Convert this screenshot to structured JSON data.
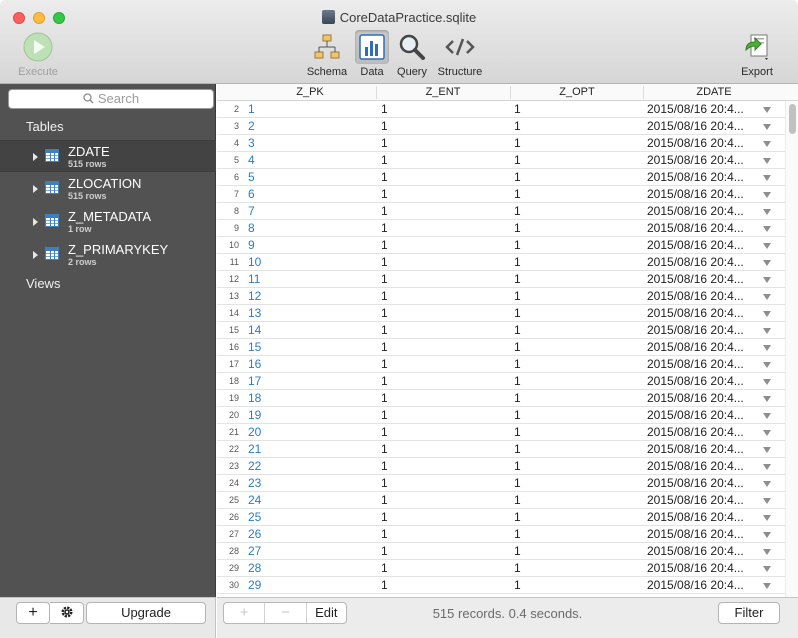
{
  "window": {
    "title": "CoreDataPractice.sqlite"
  },
  "toolbar": {
    "execute_label": "Execute",
    "schema_label": "Schema",
    "data_label": "Data",
    "query_label": "Query",
    "structure_label": "Structure",
    "export_label": "Export"
  },
  "sidebar": {
    "search_placeholder": "Search",
    "tables_heading": "Tables",
    "views_heading": "Views",
    "tables": [
      {
        "name": "ZDATE",
        "rows": "515 rows"
      },
      {
        "name": "ZLOCATION",
        "rows": "515 rows"
      },
      {
        "name": "Z_METADATA",
        "rows": "1 row"
      },
      {
        "name": "Z_PRIMARYKEY",
        "rows": "2 rows"
      }
    ],
    "add_label": "+",
    "upgrade_label": "Upgrade"
  },
  "grid": {
    "columns": [
      "Z_PK",
      "Z_ENT",
      "Z_OPT",
      "ZDATE"
    ],
    "rows": [
      {
        "n": "2",
        "pk": "1",
        "ent": "1",
        "opt": "1",
        "date": "2015/08/16 20:4..."
      },
      {
        "n": "3",
        "pk": "2",
        "ent": "1",
        "opt": "1",
        "date": "2015/08/16 20:4..."
      },
      {
        "n": "4",
        "pk": "3",
        "ent": "1",
        "opt": "1",
        "date": "2015/08/16 20:4..."
      },
      {
        "n": "5",
        "pk": "4",
        "ent": "1",
        "opt": "1",
        "date": "2015/08/16 20:4..."
      },
      {
        "n": "6",
        "pk": "5",
        "ent": "1",
        "opt": "1",
        "date": "2015/08/16 20:4..."
      },
      {
        "n": "7",
        "pk": "6",
        "ent": "1",
        "opt": "1",
        "date": "2015/08/16 20:4..."
      },
      {
        "n": "8",
        "pk": "7",
        "ent": "1",
        "opt": "1",
        "date": "2015/08/16 20:4..."
      },
      {
        "n": "9",
        "pk": "8",
        "ent": "1",
        "opt": "1",
        "date": "2015/08/16 20:4..."
      },
      {
        "n": "10",
        "pk": "9",
        "ent": "1",
        "opt": "1",
        "date": "2015/08/16 20:4..."
      },
      {
        "n": "11",
        "pk": "10",
        "ent": "1",
        "opt": "1",
        "date": "2015/08/16 20:4..."
      },
      {
        "n": "12",
        "pk": "11",
        "ent": "1",
        "opt": "1",
        "date": "2015/08/16 20:4..."
      },
      {
        "n": "13",
        "pk": "12",
        "ent": "1",
        "opt": "1",
        "date": "2015/08/16 20:4..."
      },
      {
        "n": "14",
        "pk": "13",
        "ent": "1",
        "opt": "1",
        "date": "2015/08/16 20:4..."
      },
      {
        "n": "15",
        "pk": "14",
        "ent": "1",
        "opt": "1",
        "date": "2015/08/16 20:4..."
      },
      {
        "n": "16",
        "pk": "15",
        "ent": "1",
        "opt": "1",
        "date": "2015/08/16 20:4..."
      },
      {
        "n": "17",
        "pk": "16",
        "ent": "1",
        "opt": "1",
        "date": "2015/08/16 20:4..."
      },
      {
        "n": "18",
        "pk": "17",
        "ent": "1",
        "opt": "1",
        "date": "2015/08/16 20:4..."
      },
      {
        "n": "19",
        "pk": "18",
        "ent": "1",
        "opt": "1",
        "date": "2015/08/16 20:4..."
      },
      {
        "n": "20",
        "pk": "19",
        "ent": "1",
        "opt": "1",
        "date": "2015/08/16 20:4..."
      },
      {
        "n": "21",
        "pk": "20",
        "ent": "1",
        "opt": "1",
        "date": "2015/08/16 20:4..."
      },
      {
        "n": "22",
        "pk": "21",
        "ent": "1",
        "opt": "1",
        "date": "2015/08/16 20:4..."
      },
      {
        "n": "23",
        "pk": "22",
        "ent": "1",
        "opt": "1",
        "date": "2015/08/16 20:4..."
      },
      {
        "n": "24",
        "pk": "23",
        "ent": "1",
        "opt": "1",
        "date": "2015/08/16 20:4..."
      },
      {
        "n": "25",
        "pk": "24",
        "ent": "1",
        "opt": "1",
        "date": "2015/08/16 20:4..."
      },
      {
        "n": "26",
        "pk": "25",
        "ent": "1",
        "opt": "1",
        "date": "2015/08/16 20:4..."
      },
      {
        "n": "27",
        "pk": "26",
        "ent": "1",
        "opt": "1",
        "date": "2015/08/16 20:4..."
      },
      {
        "n": "28",
        "pk": "27",
        "ent": "1",
        "opt": "1",
        "date": "2015/08/16 20:4..."
      },
      {
        "n": "29",
        "pk": "28",
        "ent": "1",
        "opt": "1",
        "date": "2015/08/16 20:4..."
      },
      {
        "n": "30",
        "pk": "29",
        "ent": "1",
        "opt": "1",
        "date": "2015/08/16 20:4..."
      }
    ]
  },
  "bottom_bar": {
    "add_label": "+",
    "remove_label": "−",
    "edit_label": "Edit",
    "status": "515 records. 0.4 seconds.",
    "filter_label": "Filter"
  },
  "icons": {
    "execute": "play-icon",
    "schema": "schema-icon",
    "data": "bar-chart-icon",
    "query": "magnifier-icon",
    "structure": "code-brackets-icon",
    "export": "export-icon",
    "settings": "gear-icon"
  }
}
